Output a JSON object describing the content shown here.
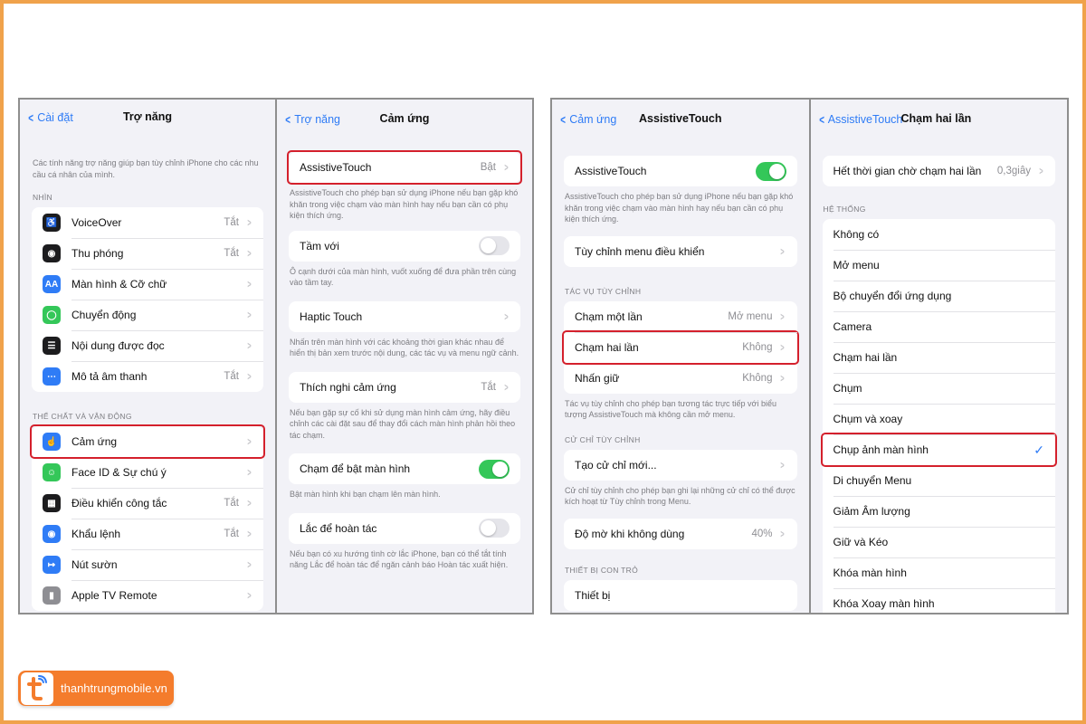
{
  "colors": {
    "accent": "#2f7cf6",
    "toggle_on": "#34c759",
    "highlight": "#d4202c",
    "brand": "#f47c2c"
  },
  "screen1": {
    "back": "Cài đặt",
    "title": "Trợ năng",
    "desc": "Các tính năng trợ năng giúp bạn tùy chỉnh iPhone cho các nhu cầu cá nhân của mình.",
    "section_vision": "NHÌN",
    "vision_items": [
      {
        "label": "VoiceOver",
        "value": "Tắt",
        "icon": "voiceover-icon"
      },
      {
        "label": "Thu phóng",
        "value": "Tắt",
        "icon": "zoom-icon"
      },
      {
        "label": "Màn hình & Cỡ chữ",
        "value": "",
        "icon": "text-size-icon"
      },
      {
        "label": "Chuyển động",
        "value": "",
        "icon": "motion-icon"
      },
      {
        "label": "Nội dung được đọc",
        "value": "",
        "icon": "spoken-content-icon"
      },
      {
        "label": "Mô tả âm thanh",
        "value": "Tắt",
        "icon": "audio-description-icon"
      }
    ],
    "section_physical": "THỂ CHẤT VÀ VẬN ĐỘNG",
    "physical_items": [
      {
        "label": "Cảm ứng",
        "value": "",
        "icon": "touch-icon"
      },
      {
        "label": "Face ID & Sự chú ý",
        "value": "",
        "icon": "faceid-icon"
      },
      {
        "label": "Điều khiển công tắc",
        "value": "Tắt",
        "icon": "switch-control-icon"
      },
      {
        "label": "Khẩu lệnh",
        "value": "Tắt",
        "icon": "voice-control-icon"
      },
      {
        "label": "Nút sườn",
        "value": "",
        "icon": "side-button-icon"
      },
      {
        "label": "Apple TV Remote",
        "value": "",
        "icon": "apple-tv-remote-icon"
      }
    ]
  },
  "screen2": {
    "back": "Trợ năng",
    "title": "Cảm ứng",
    "assistive_label": "AssistiveTouch",
    "assistive_value": "Bật",
    "assistive_desc": "AssistiveTouch cho phép bạn sử dụng iPhone nếu bạn gặp khó khăn trong việc chạm vào màn hình hay nếu bạn cần có phụ kiện thích ứng.",
    "reach_label": "Tầm với",
    "reach_desc": "Ô cạnh dưới của màn hình, vuốt xuống để đưa phần trên cùng vào tầm tay.",
    "haptic_label": "Haptic Touch",
    "haptic_desc": "Nhấn trên màn hình với các khoảng thời gian khác nhau để hiển thị bản xem trước nội dung, các tác vụ và menu ngữ cảnh.",
    "accommodations_label": "Thích nghi cảm ứng",
    "accommodations_value": "Tắt",
    "accommodations_desc": "Nếu bạn gặp sự cố khi sử dụng màn hình cảm ứng, hãy điều chỉnh các cài đặt sau để thay đổi cách màn hình phản hồi theo tác chạm.",
    "tap_wake_label": "Chạm để bật màn hình",
    "tap_wake_desc": "Bật màn hình khi bạn chạm lên màn hình.",
    "shake_label": "Lắc để hoàn tác",
    "shake_desc": "Nếu bạn có xu hướng tình cờ lắc iPhone, bạn có thể tắt tính năng Lắc để hoàn tác để ngăn cảnh báo Hoàn tác xuất hiện."
  },
  "screen3": {
    "back": "Cảm ứng",
    "title": "AssistiveTouch",
    "assistive_label": "AssistiveTouch",
    "assistive_desc": "AssistiveTouch cho phép bạn sử dụng iPhone nếu bạn gặp khó khăn trong việc chạm vào màn hình hay nếu bạn cần có phụ kiện thích ứng.",
    "customize_label": "Tùy chỉnh menu điều khiển",
    "section_custom_actions": "TÁC VỤ TÙY CHỈNH",
    "actions": [
      {
        "label": "Chạm một lần",
        "value": "Mở menu"
      },
      {
        "label": "Chạm hai lần",
        "value": "Không"
      },
      {
        "label": "Nhấn giữ",
        "value": "Không"
      }
    ],
    "actions_desc": "Tác vụ tùy chỉnh cho phép bạn tương tác trực tiếp với biểu tượng AssistiveTouch mà không cần mở menu.",
    "section_custom_gestures": "CỬ CHỈ TÙY CHỈNH",
    "new_gesture_label": "Tạo cử chỉ mới...",
    "gesture_desc": "Cử chỉ tùy chỉnh cho phép bạn ghi lại những cử chỉ có thể được kích hoạt từ Tùy chỉnh trong Menu.",
    "idle_label": "Độ mờ khi không dùng",
    "idle_value": "40%",
    "section_pointer": "THIẾT BỊ CON TRỎ",
    "pointer_partial": "Thiết bị"
  },
  "screen4": {
    "back": "AssistiveTouch",
    "title": "Chạm hai lần",
    "timeout_label": "Hết thời gian chờ chạm hai lần",
    "timeout_value": "0,3giây",
    "section_system": "HỆ THỐNG",
    "options": [
      "Không có",
      "Mở menu",
      "Bộ chuyển đổi ứng dụng",
      "Camera",
      "Chạm hai lần",
      "Chụm",
      "Chụm và xoay",
      "Chụp ảnh màn hình",
      "Di chuyển Menu",
      "Giảm Âm lượng",
      "Giữ và Kéo",
      "Khóa màn hình",
      "Khóa Xoay màn hình"
    ],
    "selected_option": "Chụp ảnh màn hình"
  },
  "brand": {
    "name": "thanhtrungmobile.vn",
    "logo_icon": "tt-logo-icon"
  }
}
